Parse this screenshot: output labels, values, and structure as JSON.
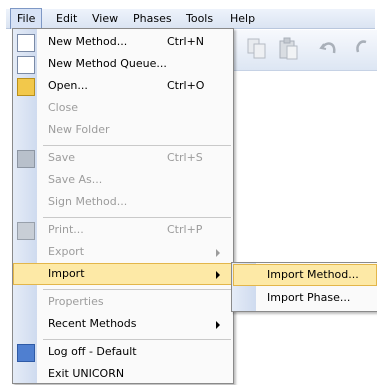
{
  "menubar": {
    "items": [
      "File",
      "Edit",
      "View",
      "Phases",
      "Tools",
      "Help"
    ]
  },
  "file_menu": {
    "new_method": {
      "label": "New Method...",
      "shortcut": "Ctrl+N"
    },
    "new_method_queue": {
      "label": "New Method Queue..."
    },
    "open": {
      "label": "Open...",
      "shortcut": "Ctrl+O"
    },
    "close": {
      "label": "Close"
    },
    "new_folder": {
      "label": "New Folder"
    },
    "save": {
      "label": "Save",
      "shortcut": "Ctrl+S"
    },
    "save_as": {
      "label": "Save As..."
    },
    "sign_method": {
      "label": "Sign Method..."
    },
    "print": {
      "label": "Print...",
      "shortcut": "Ctrl+P"
    },
    "export": {
      "label": "Export"
    },
    "import": {
      "label": "Import"
    },
    "properties": {
      "label": "Properties"
    },
    "recent_methods": {
      "label": "Recent Methods"
    },
    "log_off": {
      "label": "Log off - Default"
    },
    "exit": {
      "label": "Exit UNICORN"
    }
  },
  "import_submenu": {
    "import_method": "Import Method...",
    "import_phase": "Import Phase..."
  },
  "colors": {
    "highlight": "#fde9a6",
    "highlight_border": "#e3b64a",
    "disabled_text": "#9c9c9c",
    "gutter": "#dbe4f2"
  }
}
